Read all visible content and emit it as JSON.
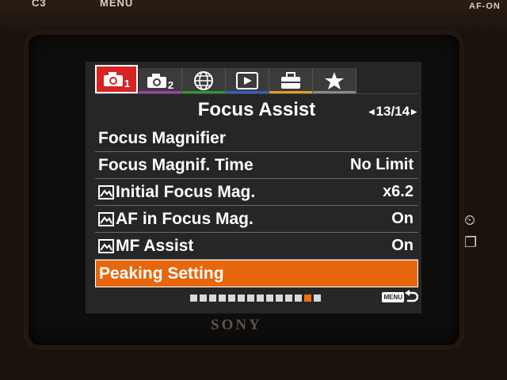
{
  "camera": {
    "top_left_label": "C3",
    "top_menu_label": "MENU",
    "top_right_label": "AF-ON",
    "brand": "SONY"
  },
  "tabs": [
    {
      "icon": "camera-icon",
      "number": "1",
      "stripe": "#d62424",
      "active": true
    },
    {
      "icon": "camera-icon",
      "number": "2",
      "stripe": "#a040b0",
      "active": false
    },
    {
      "icon": "globe-icon",
      "number": "",
      "stripe": "#2d9a30",
      "active": false
    },
    {
      "icon": "playback-icon",
      "number": "",
      "stripe": "#2a63c8",
      "active": false
    },
    {
      "icon": "toolbox-icon",
      "number": "",
      "stripe": "#e0a020",
      "active": false
    },
    {
      "icon": "star-icon",
      "number": "",
      "stripe": "#8a8a8a",
      "active": false
    }
  ],
  "header": {
    "title": "Focus Assist",
    "page_indicator": "13/14"
  },
  "menu": {
    "items": [
      {
        "label": "Focus Magnifier",
        "value": "",
        "image_icon": false
      },
      {
        "label": "Focus Magnif. Time",
        "value": "No Limit",
        "image_icon": false
      },
      {
        "label": "Initial Focus Mag.",
        "value": "x6.2",
        "image_icon": true
      },
      {
        "label": "AF in Focus Mag.",
        "value": "On",
        "image_icon": true
      },
      {
        "label": "MF Assist",
        "value": "On",
        "image_icon": true
      },
      {
        "label": "Peaking Setting",
        "value": "",
        "image_icon": false,
        "selected": true
      }
    ]
  },
  "footer": {
    "page_count": 14,
    "current_page": 13,
    "menu_badge": "MENU"
  },
  "colors": {
    "selected_row": "#e8660c",
    "active_tab": "#d62424"
  }
}
